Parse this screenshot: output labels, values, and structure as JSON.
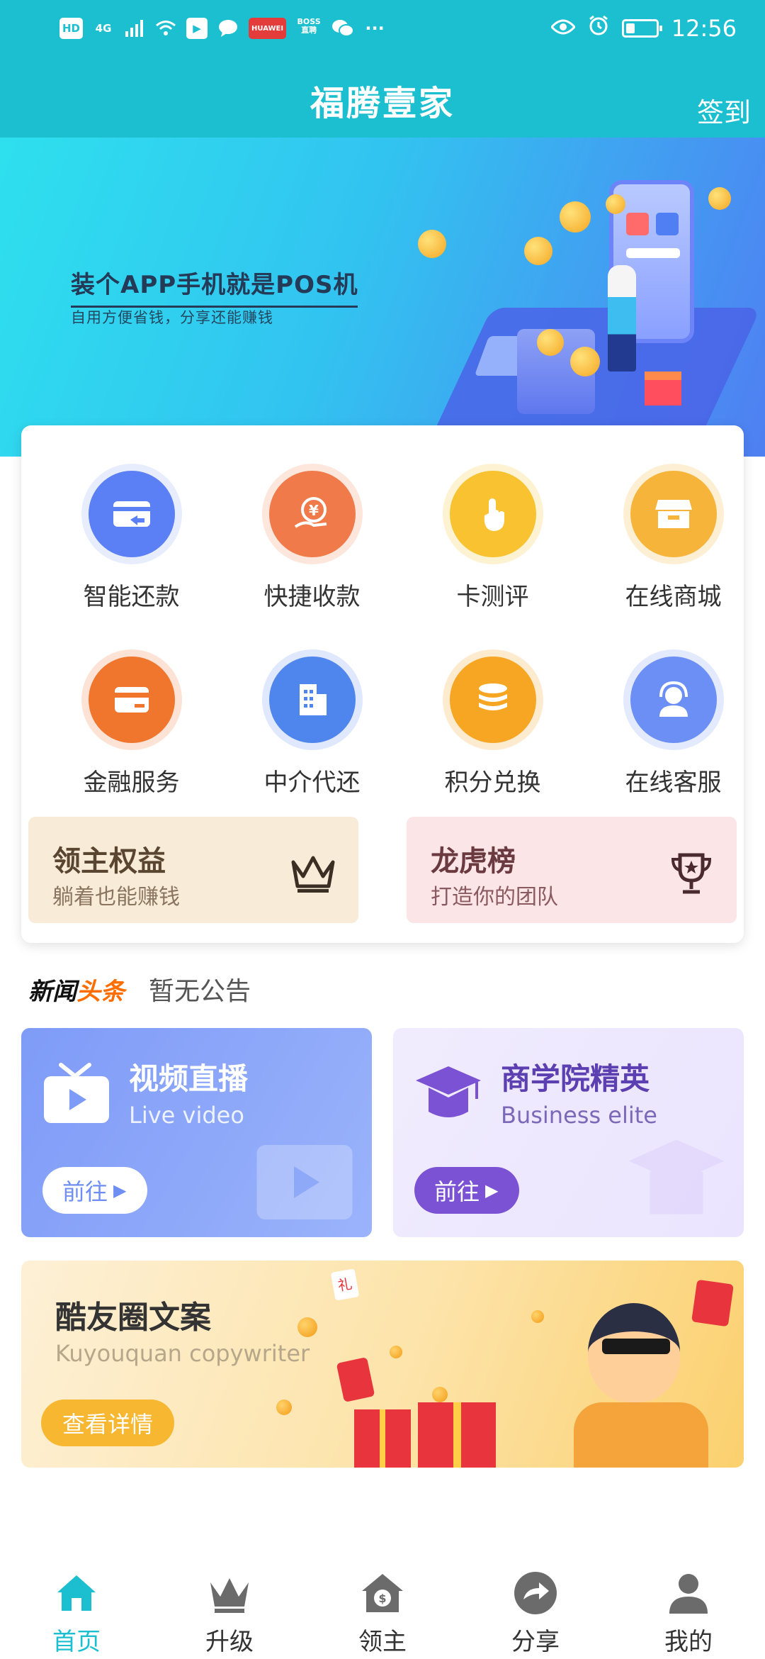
{
  "status_bar": {
    "left_icons": [
      "HD",
      "4G",
      "signal-icon",
      "wifi-icon",
      "huawei-video-icon",
      "chat-bubble-icon",
      "huawei-icon",
      "boss-icon",
      "wechat-icon",
      "more-icon"
    ],
    "hd": "HD",
    "network": "4G",
    "boss": "BOSS 直聘",
    "huawei": "HUAWEI",
    "more": "···",
    "time": "12:56"
  },
  "header": {
    "title": "福腾壹家",
    "checkin_label": "签到",
    "background_color": "#1cbfd0"
  },
  "banner": {
    "title": "装个APP手机就是POS机",
    "subtitle": "自用方便省钱，分享还能赚钱"
  },
  "services": [
    {
      "label": "智能还款",
      "icon": "card-return-icon",
      "color": "#5b7ff5"
    },
    {
      "label": "快捷收款",
      "icon": "yuan-hand-icon",
      "color": "#f07a4a"
    },
    {
      "label": "卡测评",
      "icon": "tap-finger-icon",
      "color": "#f8c230"
    },
    {
      "label": "在线商城",
      "icon": "shop-icon",
      "color": "#f6b53a"
    },
    {
      "label": "金融服务",
      "icon": "bank-card-icon",
      "color": "#f0762e"
    },
    {
      "label": "中介代还",
      "icon": "building-icon",
      "color": "#4f86ee"
    },
    {
      "label": "积分兑换",
      "icon": "coins-stack-icon",
      "color": "#f6a623"
    },
    {
      "label": "在线客服",
      "icon": "headset-icon",
      "color": "#6b8ff5"
    }
  ],
  "benefits": [
    {
      "title": "领主权益",
      "subtitle": "躺着也能赚钱",
      "icon": "crown-icon"
    },
    {
      "title": "龙虎榜",
      "subtitle": "打造你的团队",
      "icon": "trophy-icon"
    }
  ],
  "news": {
    "logo_part1": "新闻",
    "logo_part2": "头条",
    "text": "暂无公告"
  },
  "tiles": [
    {
      "title": "视频直播",
      "subtitle": "Live video",
      "button": "前往",
      "icon": "tv-play-icon"
    },
    {
      "title": "商学院精英",
      "subtitle": "Business elite",
      "button": "前往",
      "icon": "graduation-cap-icon"
    }
  ],
  "copywriter": {
    "title": "酷友圈文案",
    "subtitle": "Kuyouquan copywriter",
    "button": "查看详情",
    "badge": "礼"
  },
  "bottom_nav": [
    {
      "label": "首页",
      "icon": "home-icon",
      "active": true
    },
    {
      "label": "升级",
      "icon": "crown-icon",
      "active": false
    },
    {
      "label": "领主",
      "icon": "house-dollar-icon",
      "active": false
    },
    {
      "label": "分享",
      "icon": "share-arrow-icon",
      "active": false
    },
    {
      "label": "我的",
      "icon": "user-icon",
      "active": false
    }
  ],
  "colors": {
    "primary": "#1cbfd0",
    "benefit1_bg": "#f8ecd8",
    "benefit2_bg": "#fbe5e6",
    "video_btn_text": "#6f8ef3",
    "biz_btn_bg": "#7b52d3",
    "copy_btn_bg": "#f7b731"
  }
}
